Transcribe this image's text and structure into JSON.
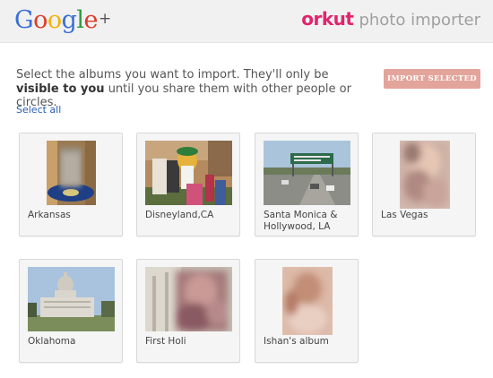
{
  "header": {
    "google_logo_letters": [
      "G",
      "o",
      "o",
      "g",
      "l",
      "e"
    ],
    "google_plus": "+",
    "orkut_word": "orkut",
    "importer_word": "photo importer"
  },
  "intro": {
    "part1": "Select the albums you want to import. They'll only be ",
    "bold": "visible to you",
    "part2": " until you share them with other people or circles."
  },
  "actions": {
    "import_button": "IMPORT SELECTED",
    "select_all": "Select all"
  },
  "albums": [
    {
      "label": "Arkansas"
    },
    {
      "label": "Disneyland,CA"
    },
    {
      "label": "Santa Monica & Hollywood, LA"
    },
    {
      "label": "Las Vegas"
    },
    {
      "label": "Oklahoma"
    },
    {
      "label": "First Holi"
    },
    {
      "label": "Ishan's album"
    }
  ],
  "colors": {
    "orkut_pink": "#e0246e",
    "import_button_bg": "#e3a49b",
    "link_blue": "#2a5db0"
  }
}
